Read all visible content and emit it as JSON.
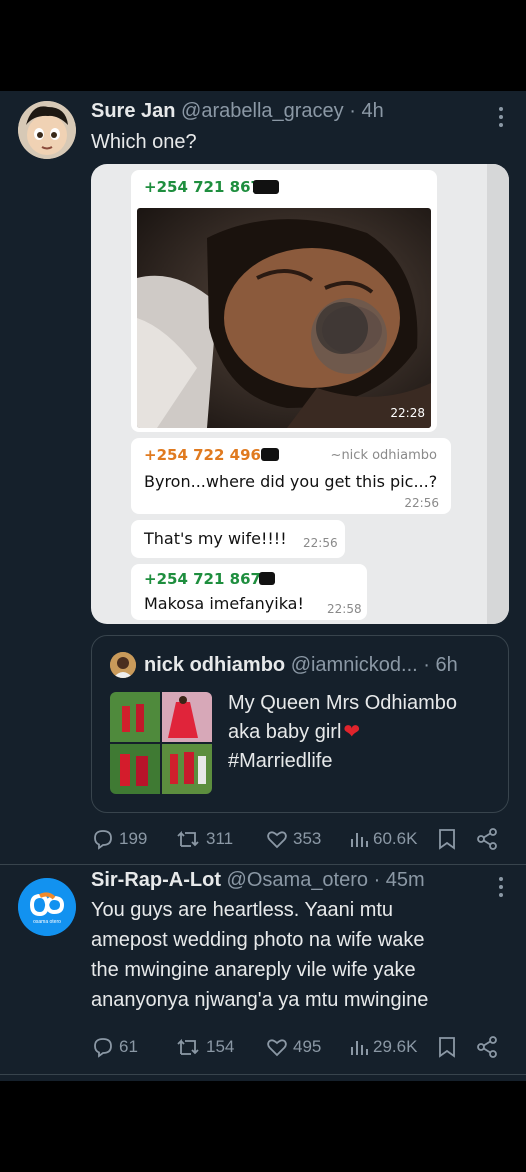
{
  "tweet1": {
    "name": "Sure Jan",
    "handle": "@arabella_gracey",
    "time": "· 4h",
    "text": "Which one?",
    "chat": {
      "m1_phone": "+254 721 867",
      "m1_time": "22:28",
      "m2_phone": "+254 722 4964",
      "m2_alias": "~nick odhiambo",
      "m2_text": "Byron...where did you get this pic...?",
      "m2_time": "22:56",
      "m3_text": "That's my wife!!!!",
      "m3_time": "22:56",
      "m4_phone": "+254 721 8677",
      "m4_text": "Makosa imefanyika!",
      "m4_time": "22:58"
    },
    "quote": {
      "name": "nick odhiambo",
      "handle": "@iamnickod...",
      "time": "· 6h",
      "line1": "My Queen Mrs Odhiambo",
      "line2": "aka baby girl",
      "line3": "#Marriedlife"
    },
    "stats": {
      "replies": "199",
      "retweets": "311",
      "likes": "353",
      "views": "60.6K"
    }
  },
  "tweet2": {
    "name": "Sir-Rap-A-Lot",
    "handle": "@Osama_otero",
    "time": "· 45m",
    "lines": [
      "You guys are heartless. Yaani mtu",
      "amepost wedding photo na wife wake",
      "the mwingine anareply vile wife yake",
      "ananyonya njwang'a ya mtu mwingine"
    ],
    "avatar_text": "osama otero",
    "stats": {
      "replies": "61",
      "retweets": "154",
      "likes": "495",
      "views": "29.6K"
    }
  },
  "colors": {
    "background": "#15202b",
    "text": "#e7e9ea",
    "muted": "#8b98a5",
    "border": "#38444d",
    "phone_green": "#1e8e3e",
    "heart": "#f91880"
  },
  "icons": [
    "reply-icon",
    "retweet-icon",
    "like-icon",
    "views-icon",
    "bookmark-icon",
    "share-icon",
    "more-icon",
    "heart-emoji-icon"
  ]
}
